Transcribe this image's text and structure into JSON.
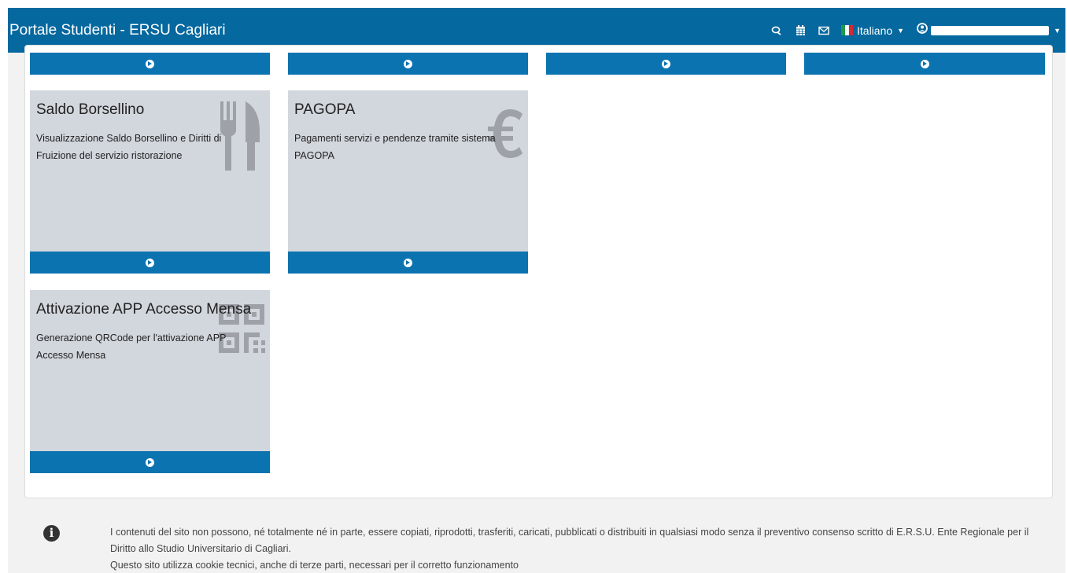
{
  "navbar": {
    "title": "Portale Studenti - ERSU Cagliari",
    "icons": [
      "chat-icon",
      "calendar-icon",
      "envelope-icon"
    ],
    "language": "Italiano",
    "user_icon": "user-circle-icon"
  },
  "cards": [
    {
      "title": "Saldo Borsellino",
      "description": "Visualizzazione Saldo Borsellino e Diritti di Fruizione del servizio ristorazione",
      "icon": "cutlery-icon"
    },
    {
      "title": "PAGOPA",
      "description": "Pagamenti servizi e pendenze tramite sistema PAGOPA",
      "icon": "euro-icon"
    },
    {
      "title": "Attivazione APP Accesso Mensa",
      "description": "Generazione QRCode per l'attivazione APP Accesso Mensa",
      "icon": "qrcode-icon"
    }
  ],
  "footer": {
    "icon": "info-icon",
    "line1": "I contenuti del sito non possono, né totalmente né in parte, essere copiati, riprodotti, trasferiti, caricati, pubblicati o distribuiti in qualsiasi modo senza il preventivo consenso scritto di E.R.S.U. Ente Regionale per il Diritto allo Studio Universitario di Cagliari.",
    "line2": "Questo sito utilizza cookie tecnici, anche di terze parti, necessari per il corretto funzionamento"
  },
  "colors": {
    "navbar": "#05689e",
    "card_bar": "#0b73b0",
    "card_bg": "#d2d6dd"
  }
}
